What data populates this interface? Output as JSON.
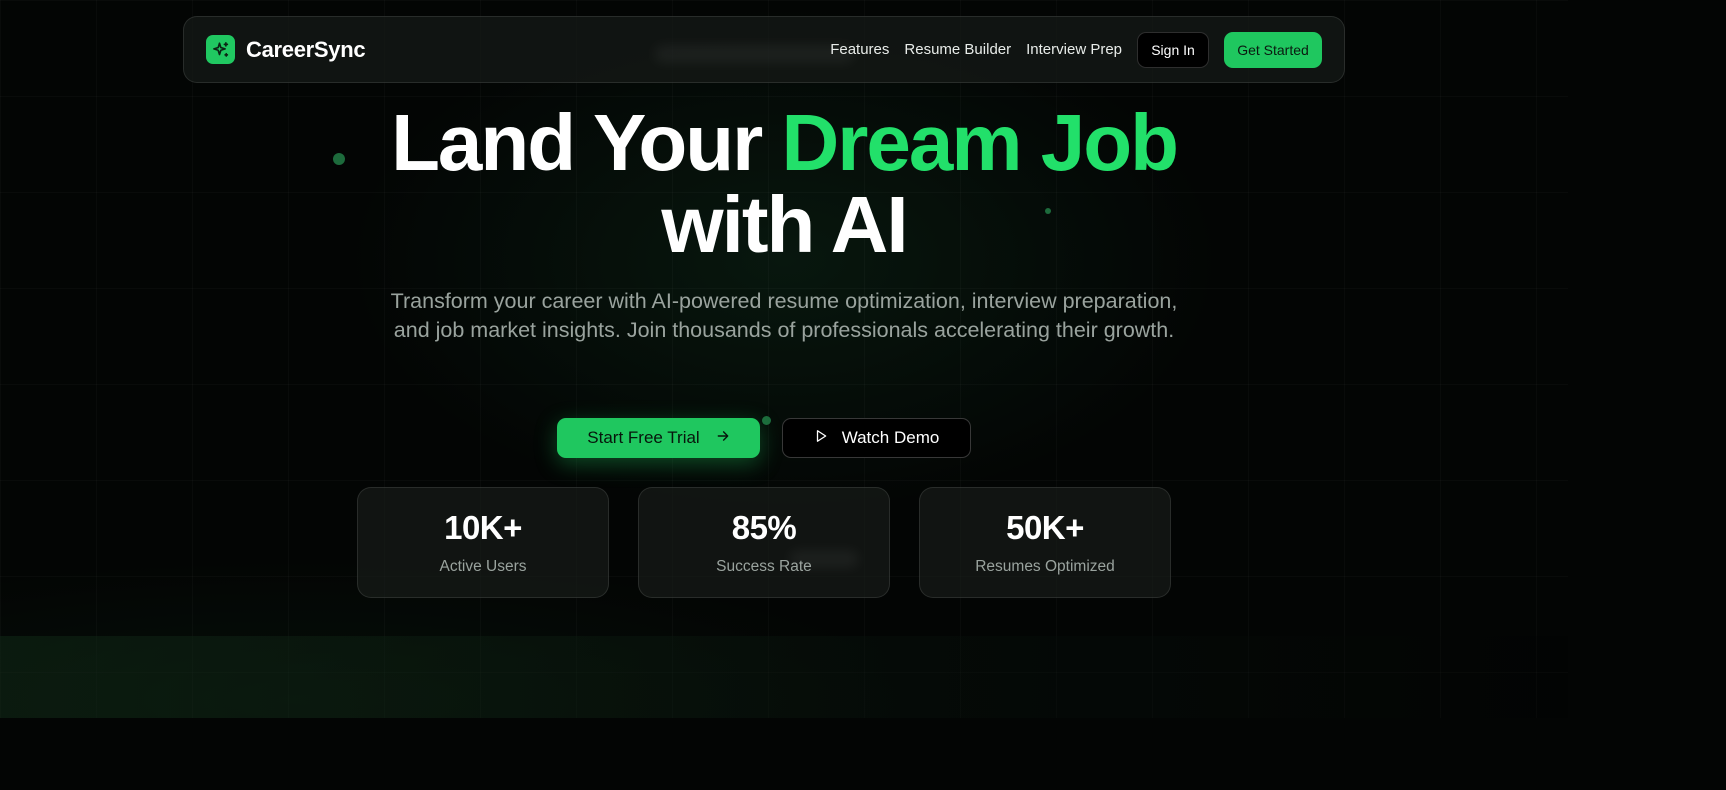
{
  "colors": {
    "background": "#030504",
    "accent": "#1fc75f",
    "headline_accent": "#22e06a",
    "muted_text": "#9aa39e"
  },
  "brand": {
    "name": "CareerSync",
    "logo_icon": "sparkles-icon"
  },
  "nav": {
    "links": [
      "Features",
      "Resume Builder",
      "Interview Prep"
    ],
    "sign_in": "Sign In",
    "get_started": "Get Started"
  },
  "hero": {
    "title_part1": "Land Your ",
    "title_accent": "Dream Job",
    "title_part2": "with AI",
    "subtitle": "Transform your career with AI-powered resume optimization, interview preparation, and job market insights. Join thousands of professionals accelerating their growth."
  },
  "cta": {
    "primary": {
      "label": "Start Free Trial",
      "icon": "arrow-right-icon"
    },
    "secondary": {
      "label": "Watch Demo",
      "icon": "play-icon"
    }
  },
  "stats": [
    {
      "value": "10K+",
      "label": "Active Users"
    },
    {
      "value": "85%",
      "label": "Success Rate"
    },
    {
      "value": "50K+",
      "label": "Resumes Optimized"
    }
  ]
}
